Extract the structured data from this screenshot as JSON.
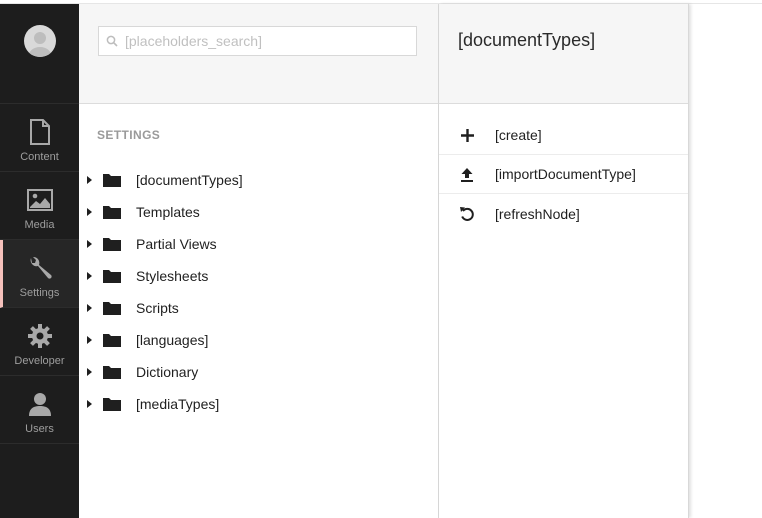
{
  "search": {
    "placeholder": "[placeholders_search]"
  },
  "sections": [
    {
      "label": "Content",
      "icon": "document-icon"
    },
    {
      "label": "Media",
      "icon": "image-icon"
    },
    {
      "label": "Settings",
      "icon": "wrench-icon",
      "active": true
    },
    {
      "label": "Developer",
      "icon": "gear-icon"
    },
    {
      "label": "Users",
      "icon": "user-icon"
    }
  ],
  "tree": {
    "title": "SETTINGS",
    "items": [
      {
        "label": "[documentTypes]"
      },
      {
        "label": "Templates"
      },
      {
        "label": "Partial Views"
      },
      {
        "label": "Stylesheets"
      },
      {
        "label": "Scripts"
      },
      {
        "label": "[languages]"
      },
      {
        "label": "Dictionary"
      },
      {
        "label": "[mediaTypes]"
      }
    ]
  },
  "actions": {
    "title": "[documentTypes]",
    "items": [
      {
        "label": "[create]",
        "icon": "plus-icon"
      },
      {
        "label": "[importDocumentType]",
        "icon": "upload-icon"
      },
      {
        "label": "[refreshNode]",
        "icon": "refresh-icon"
      }
    ]
  },
  "colors": {
    "appbar": "#1d1d1d",
    "active_accent": "#f5c1bc",
    "panel_header": "#f6f6f6"
  }
}
